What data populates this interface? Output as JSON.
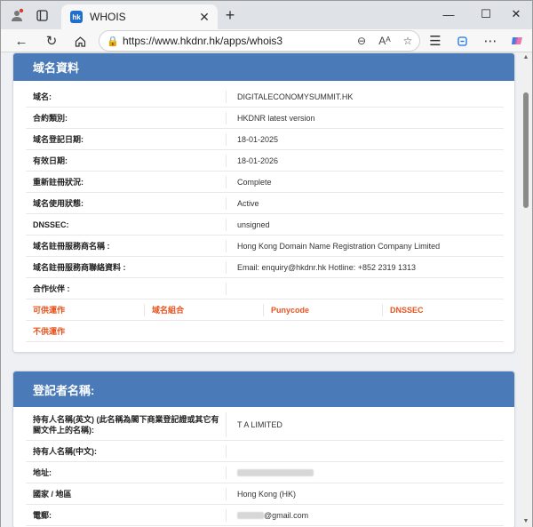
{
  "browser": {
    "tab_title": "WHOIS",
    "tab_favicon": "hk",
    "url": "https://www.hkdnr.hk/apps/whois3",
    "new_tab": "+",
    "minimize": "—",
    "maximize": "☐",
    "close": "✕"
  },
  "panel1": {
    "title": "域名資料",
    "rows": [
      {
        "label": "域名:",
        "value": "DIGITALECONOMYSUMMIT.HK"
      },
      {
        "label": "合約類別:",
        "value": "HKDNR latest version"
      },
      {
        "label": "域名登記日期:",
        "value": "18-01-2025"
      },
      {
        "label": "有效日期:",
        "value": "18-01-2026"
      },
      {
        "label": "重新註冊狀況:",
        "value": "Complete"
      },
      {
        "label": "域名使用狀態:",
        "value": "Active"
      },
      {
        "label": "DNSSEC:",
        "value": "unsigned"
      },
      {
        "label": "域名註冊服務商名稱 :",
        "value": "Hong Kong Domain Name Registration Company Limited"
      },
      {
        "label": "域名註冊服務商聯絡資料 :",
        "value": "Email: enquiry@hkdnr.hk Hotline: +852 2319 1313"
      },
      {
        "label": "合作伙伴 :",
        "value": ""
      }
    ],
    "options_row": [
      "可供運作",
      "域名組合",
      "Punycode",
      "DNSSEC"
    ],
    "unavailable_row": [
      "不供運作"
    ]
  },
  "panel2": {
    "title": "登記者名稱:",
    "rows": [
      {
        "label": "持有人名稱(英文) (此名稱為閣下商業登記證或其它有關文件上的名稱):",
        "value": "T A LIMITED"
      },
      {
        "label": "持有人名稱(中文):",
        "value": ""
      },
      {
        "label": "地址:",
        "value": ""
      },
      {
        "label": "國家 / 地區",
        "value": "Hong Kong (HK)"
      },
      {
        "label": "電郵:",
        "value": "@gmail.com"
      }
    ]
  },
  "colors": {
    "panel_header": "#4a7ab7",
    "option_text": "#e8541e"
  }
}
